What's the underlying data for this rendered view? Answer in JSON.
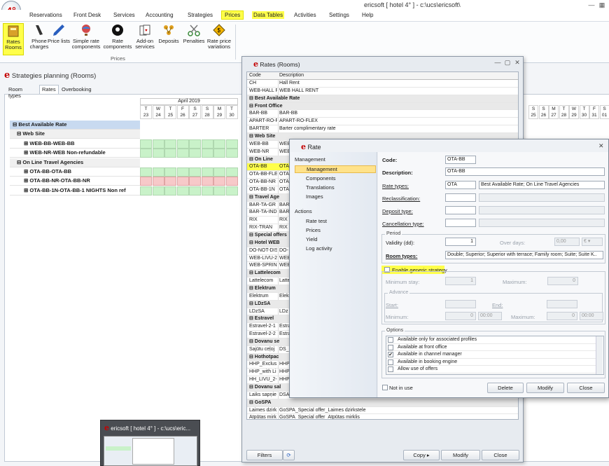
{
  "app": {
    "logo": "4°",
    "title": "ericsoft [ hotel 4° ] - c:\\ucs\\ericsoft\\"
  },
  "menu": [
    "Reservations",
    "Front Desk",
    "Services",
    "Accounting",
    "Strategies",
    "Prices",
    "Data Tables",
    "Activities",
    "Settings",
    "Help"
  ],
  "ribbon": {
    "buttons": [
      "Rates Rooms",
      "Phone charges",
      "Price lists",
      "Simple rate components",
      "Rate components",
      "Add-on services",
      "Deposits",
      "Penalties",
      "Rate price variations"
    ],
    "group_label": "Prices"
  },
  "strategies": {
    "title": "Strategies planning (Rooms)",
    "tabs": [
      "Room types",
      "Rates",
      "Overbooking"
    ],
    "month": "April 2019",
    "days": [
      {
        "dow": "T",
        "d": "23"
      },
      {
        "dow": "W",
        "d": "24"
      },
      {
        "dow": "T",
        "d": "25"
      },
      {
        "dow": "F",
        "d": "26"
      },
      {
        "dow": "S",
        "d": "27"
      },
      {
        "dow": "S",
        "d": "28"
      },
      {
        "dow": "M",
        "d": "29"
      },
      {
        "dow": "T",
        "d": "30"
      }
    ],
    "right_days": [
      {
        "dow": "S",
        "d": "25"
      },
      {
        "dow": "S",
        "d": "26"
      },
      {
        "dow": "M",
        "d": "27"
      },
      {
        "dow": "T",
        "d": "28"
      },
      {
        "dow": "W",
        "d": "29"
      },
      {
        "dow": "T",
        "d": "30"
      },
      {
        "dow": "F",
        "d": "31"
      },
      {
        "dow": "S",
        "d": "01"
      }
    ],
    "rows": [
      {
        "label": "⊟  Best Available Rate",
        "kind": "group"
      },
      {
        "label": "⊟  Web Site",
        "kind": "sub"
      },
      {
        "label": "⊞  WEB-BB-WEB-BB",
        "kind": "item",
        "color": "green"
      },
      {
        "label": "⊞  WEB-NR-WEB Non-refundable",
        "kind": "item",
        "color": "green"
      },
      {
        "label": "⊟  On Line Travel Agencies",
        "kind": "sub"
      },
      {
        "label": "⊞  OTA-BB-OTA-BB",
        "kind": "item",
        "color": "green"
      },
      {
        "label": "⊞  OTA-BB-NR-OTA-BB-NR",
        "kind": "item",
        "color": "red"
      },
      {
        "label": "⊞  OTA-BB-1N-OTA-BB-1 NIGHTS Non ref",
        "kind": "item",
        "color": "green"
      }
    ]
  },
  "thumb_title": "ericsoft [ hotel 4° ] - c:\\ucs\\eric...",
  "rates_window": {
    "title": "Rates (Rooms)",
    "header": {
      "code": "Code",
      "desc": "Description"
    },
    "rows": [
      {
        "code": "CH",
        "desc": "Hall Rent"
      },
      {
        "code": "WEB-HALL R",
        "desc": "WEB HALL RENT"
      },
      {
        "code": "⊟ Best Available Rate",
        "desc": "",
        "grp": true
      },
      {
        "code": "⊟ Front Office",
        "desc": "",
        "grp": true
      },
      {
        "code": "BAR-BB",
        "desc": "BAR-BB"
      },
      {
        "code": "APART-RO-F",
        "desc": "APART-RO-FLEX"
      },
      {
        "code": "BARTER",
        "desc": "Barter complimentary rate"
      },
      {
        "code": "⊟ Web Site",
        "desc": "",
        "grp": true
      },
      {
        "code": "WEB-BB",
        "desc": "WEB"
      },
      {
        "code": "WEB-NR",
        "desc": "WEB"
      },
      {
        "code": "⊟ On Line",
        "desc": "",
        "grp": true
      },
      {
        "code": "OTA-BB",
        "desc": "OTA",
        "sel": true
      },
      {
        "code": "OTA-BB-FLE",
        "desc": "OTA"
      },
      {
        "code": "OTA-BB-NR",
        "desc": "OTA"
      },
      {
        "code": "OTA-BB-1N",
        "desc": "OTA"
      },
      {
        "code": "⊟ Travel Age",
        "desc": "",
        "grp": true
      },
      {
        "code": "BAR-TA-GR",
        "desc": "BAR"
      },
      {
        "code": "BAR-TA-IND",
        "desc": "BAR"
      },
      {
        "code": "RIX",
        "desc": "RIX"
      },
      {
        "code": "RIX-TRAN",
        "desc": "RIX"
      },
      {
        "code": "⊟ Special offers",
        "desc": "",
        "grp": true
      },
      {
        "code": "⊟ Hotel WEB",
        "desc": "",
        "grp": true
      },
      {
        "code": "DO-NOT-DIS",
        "desc": "DO-"
      },
      {
        "code": "WEB-LIVU-2",
        "desc": "WEB"
      },
      {
        "code": "WEB-SPRIN",
        "desc": "WEB"
      },
      {
        "code": "⊟ Lattelecom",
        "desc": "",
        "grp": true
      },
      {
        "code": "Lattelecom",
        "desc": "Latte"
      },
      {
        "code": "⊟ Elektrum",
        "desc": "",
        "grp": true
      },
      {
        "code": "Elektrum",
        "desc": "Elek"
      },
      {
        "code": "⊟ LDzSA",
        "desc": "",
        "grp": true
      },
      {
        "code": "LDzSA",
        "desc": "LDz"
      },
      {
        "code": "⊟ Estravel",
        "desc": "",
        "grp": true
      },
      {
        "code": "Estravel-2-1",
        "desc": "Estra"
      },
      {
        "code": "Estravel-2-2",
        "desc": "Estra"
      },
      {
        "code": "⊟ Dovanu se",
        "desc": "",
        "grp": true
      },
      {
        "code": "Sajūtu ceļoj",
        "desc": "DS_"
      },
      {
        "code": "⊟ Hothotpac",
        "desc": "",
        "grp": true
      },
      {
        "code": "HHP_Exclus",
        "desc": "HHP"
      },
      {
        "code": "HHP_with Li",
        "desc": "HHP"
      },
      {
        "code": "HH_LIVU_2-",
        "desc": "HHP"
      },
      {
        "code": "⊟ Dovanu sal",
        "desc": "",
        "grp": true
      },
      {
        "code": "Laiks sapņie",
        "desc": "DSA"
      },
      {
        "code": "⊟ GoSPA",
        "desc": "",
        "grp": true
      },
      {
        "code": "Laimes dzirk",
        "desc": "GoSPA_Special offer_Laimes dzirkstele"
      },
      {
        "code": "Atpūtas mirk",
        "desc": "GoSPA_Special offer_Atpūtas mirklis"
      }
    ],
    "buttons": {
      "filters": "Filters",
      "copy": "Copy",
      "modify": "Modify",
      "close": "Close"
    }
  },
  "rate_dialog": {
    "title": "Rate",
    "nav": {
      "management_header": "Management",
      "management_items": [
        "Management",
        "Components",
        "Translations",
        "Images"
      ],
      "actions_header": "Actions",
      "action_items": [
        "Rate test",
        "Prices",
        "Yield",
        "Log activity"
      ]
    },
    "code_label": "Code:",
    "code": "OTA-BB",
    "description_label": "Description:",
    "description": "OTA-BB",
    "rate_types_label": "Rate types:",
    "rate_type_code": "OTA",
    "rate_type_desc": "Best Available Rate; On Line Travel Agencies",
    "reclassification_label": "Reclassification:",
    "deposit_type_label": "Deposit type:",
    "cancellation_type_label": "Cancellation type:",
    "period_legend": "Period",
    "validity_label": "Validity (dd):",
    "validity": "1",
    "over_days_label": "Over days:",
    "over_days": "0,00",
    "currency": "€",
    "room_types_label": "Room types:",
    "room_types": "Double; Superior; Superior with terrace; Family room; Suite; Suite K..",
    "generic_strategy": "Enable generic strategy",
    "min_stay_label": "Minimum stay:",
    "min_stay": "1",
    "maximum_label": "Maximum:",
    "maximum": "0",
    "advance_legend": "Advance",
    "start_label": "Start:",
    "end_label": "End:",
    "adv_min_label": "Minimum:",
    "adv_min": "0",
    "adv_min_time": "00:00",
    "adv_max_label": "Maximum:",
    "adv_max": "0",
    "adv_max_time": "00:00",
    "options_legend": "Options",
    "options": [
      {
        "label": "Available only for associated profiles",
        "checked": false
      },
      {
        "label": "Available at front office",
        "checked": false
      },
      {
        "label": "Available in channel manager",
        "checked": true
      },
      {
        "label": "Available in booking engine",
        "checked": false
      },
      {
        "label": "Allow use of offers",
        "checked": false
      }
    ],
    "not_in_use": "Not in use",
    "buttons": {
      "delete": "Delete",
      "modify": "Modify",
      "close": "Close"
    }
  }
}
